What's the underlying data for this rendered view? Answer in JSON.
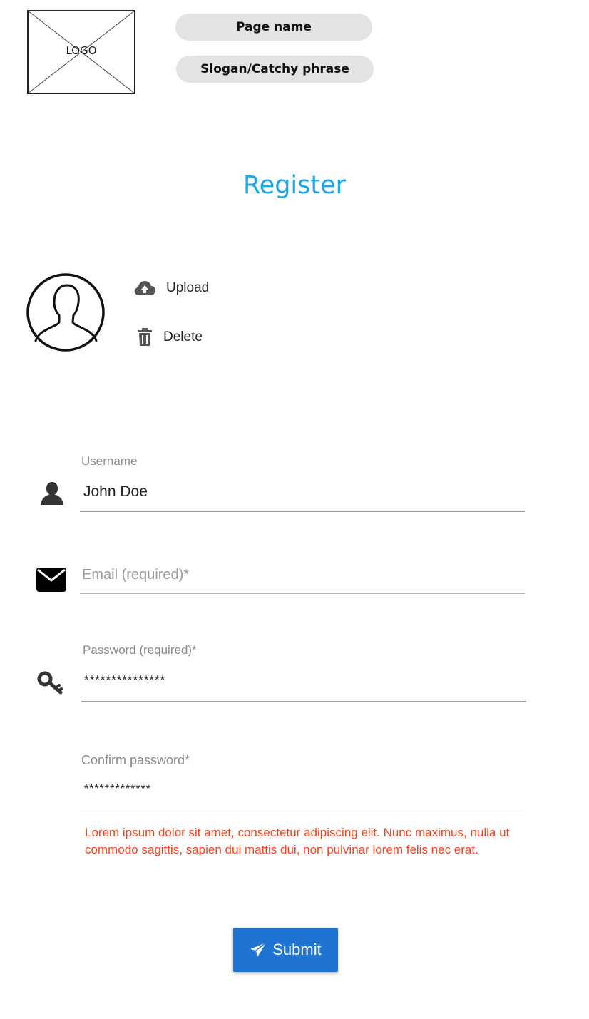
{
  "header": {
    "logo_text": "LOGO",
    "page_name": "Page name",
    "slogan": "Slogan/Catchy phrase"
  },
  "title": "Register",
  "colors": {
    "title": "#1aa7ee",
    "submit_bg": "#1f74d1",
    "error": "#f4431e",
    "pill_bg": "#e3e3e3"
  },
  "avatar": {
    "icon": "user-silhouette-icon",
    "actions": [
      {
        "label": "Upload",
        "icon": "cloud-upload-icon"
      },
      {
        "label": "Delete",
        "icon": "trash-icon"
      }
    ]
  },
  "form": {
    "username": {
      "label": "Username",
      "value": "John Doe",
      "icon": "user-icon"
    },
    "email": {
      "placeholder": "Email (required)*",
      "icon": "envelope-icon"
    },
    "password": {
      "label": "Password (required)*",
      "value": "***************",
      "icon": "key-icon"
    },
    "confirm_password": {
      "label": "Confirm password*",
      "value": "*************"
    },
    "error_message": "Lorem ipsum dolor sit amet, consectetur adipiscing elit. Nunc maximus, nulla ut commodo sagittis, sapien dui mattis dui, non pulvinar lorem felis nec erat."
  },
  "submit": {
    "label": "Submit",
    "icon": "paper-plane-icon"
  }
}
